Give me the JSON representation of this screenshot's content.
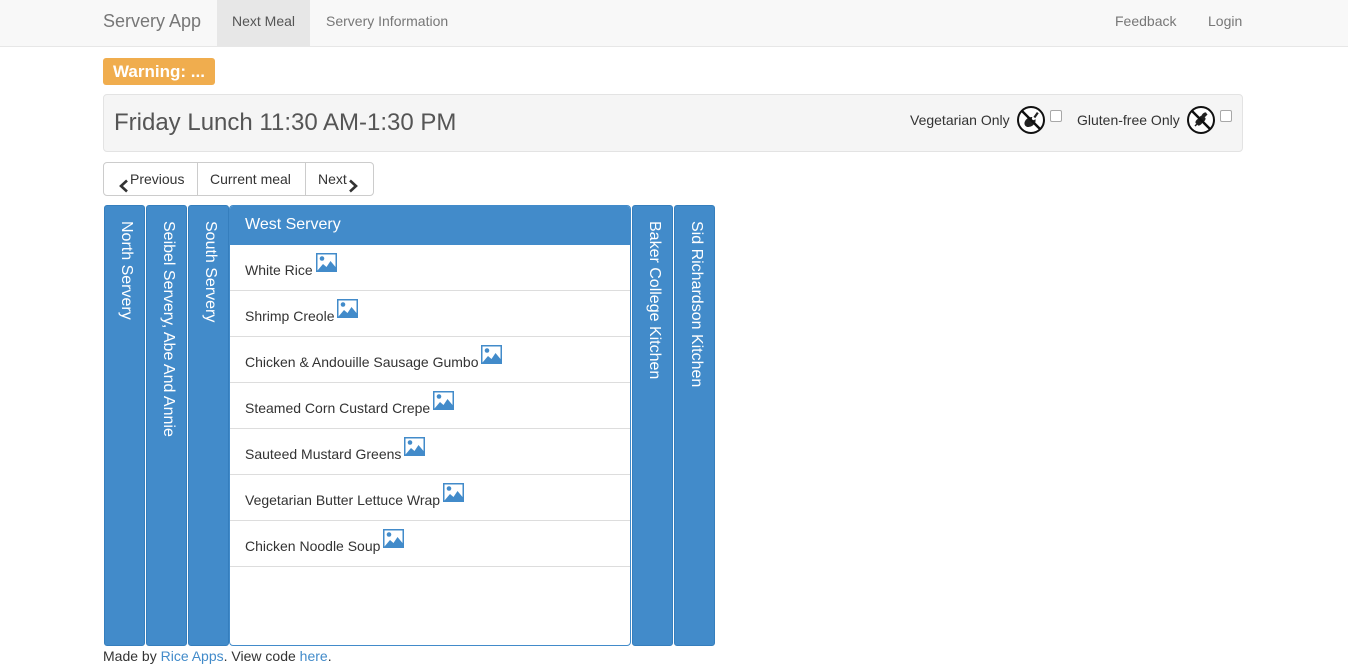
{
  "navbar": {
    "brand": "Servery App",
    "tabs": [
      {
        "label": "Next Meal",
        "active": true
      },
      {
        "label": "Servery Information",
        "active": false
      }
    ],
    "right": [
      "Feedback",
      "Login"
    ]
  },
  "warning": "Warning: ...",
  "meal": {
    "title": "Friday Lunch 11:30 AM-1:30 PM",
    "filters": {
      "vegetarian": {
        "label": "Vegetarian Only",
        "icon": "no-meat-icon",
        "checked": false
      },
      "gluten_free": {
        "label": "Gluten-free Only",
        "icon": "no-gluten-icon",
        "checked": false
      }
    }
  },
  "nav_buttons": {
    "previous": "Previous",
    "current": "Current meal",
    "next": "Next"
  },
  "serveries": [
    {
      "name": "North Servery",
      "expanded": false
    },
    {
      "name": "Seibel Servery, Abe And Annie",
      "expanded": false
    },
    {
      "name": "South Servery",
      "expanded": false
    },
    {
      "name": "West Servery",
      "expanded": true
    },
    {
      "name": "Baker College Kitchen",
      "expanded": false
    },
    {
      "name": "Sid Richardson Kitchen",
      "expanded": false
    }
  ],
  "dishes": [
    "White Rice",
    "Shrimp Creole",
    "Chicken & Andouille Sausage Gumbo",
    "Steamed Corn Custard Crepe",
    "Sauteed Mustard Greens",
    "Vegetarian Butter Lettuce Wrap",
    "Chicken Noodle Soup"
  ],
  "footer": {
    "prefix": "Made by",
    "link1": "Rice Apps",
    "middle": ". View code",
    "link2": "here",
    "suffix": "."
  },
  "colors": {
    "primary": "#428bca",
    "warning": "#f0ad4e",
    "navbar_bg": "#f8f8f8"
  }
}
